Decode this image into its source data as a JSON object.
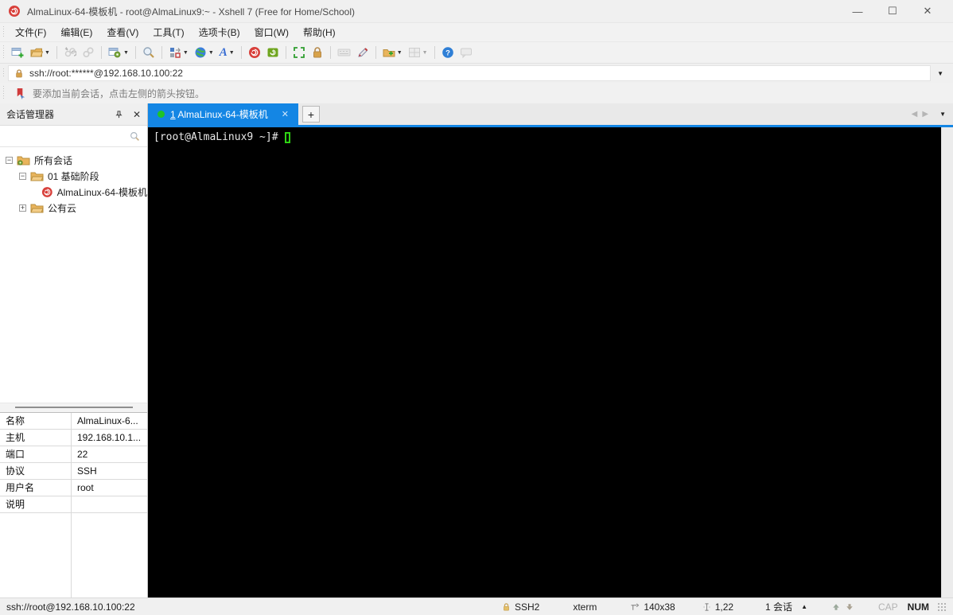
{
  "window": {
    "title": "AlmaLinux-64-模板机 - root@AlmaLinux9:~ - Xshell 7 (Free for Home/School)"
  },
  "menubar": {
    "items": [
      "文件(F)",
      "编辑(E)",
      "查看(V)",
      "工具(T)",
      "选项卡(B)",
      "窗口(W)",
      "帮助(H)"
    ]
  },
  "toolbar": {
    "buttons": [
      "new-session",
      "open-sessions",
      "disconnect",
      "reconnect",
      "session-properties",
      "find",
      "layout",
      "encoding-globe",
      "font",
      "new-xshell-window",
      "new-xftp-transfer",
      "fullscreen",
      "lock-screen",
      "virtual-keyboard",
      "compose-pen",
      "new-session-folder",
      "tile-windows",
      "help",
      "feedback"
    ]
  },
  "address_bar": {
    "url": "ssh://root:******@192.168.10.100:22"
  },
  "info_bar": {
    "message": "要添加当前会话，点击左侧的箭头按钮。"
  },
  "session_manager": {
    "title": "会话管理器",
    "tree": [
      {
        "label": "所有会话",
        "level": 0,
        "expanded": true
      },
      {
        "label": "01 基础阶段",
        "level": 1,
        "expanded": true
      },
      {
        "label": "AlmaLinux-64-模板机",
        "level": 2
      },
      {
        "label": "公有云",
        "level": 1,
        "expanded": false
      }
    ]
  },
  "tabs": {
    "active_number": "1",
    "active_label": "AlmaLinux-64-模板机",
    "new_tab_label": "+"
  },
  "terminal": {
    "prompt": "[root@AlmaLinux9 ~]# "
  },
  "properties": {
    "rows": [
      {
        "label": "名称",
        "value": "AlmaLinux-6..."
      },
      {
        "label": "主机",
        "value": "192.168.10.1..."
      },
      {
        "label": "端口",
        "value": "22"
      },
      {
        "label": "协议",
        "value": "SSH"
      },
      {
        "label": "用户名",
        "value": "root"
      },
      {
        "label": "说明",
        "value": ""
      }
    ]
  },
  "status_bar": {
    "url": "ssh://root@192.168.10.100:22",
    "protocol": "SSH2",
    "terminal_type": "xterm",
    "size": "140x38",
    "cursor_position": "1,22",
    "session_count": "1 会话",
    "cap": "CAP",
    "num": "NUM"
  },
  "colors": {
    "accent_blue": "#1486e4",
    "session_dot_green": "#1fc426",
    "cursor_green": "#2ed313",
    "terminal_bg": "#000000",
    "xshell_red": "#d8403b",
    "xftp_green": "#6fa51f",
    "folder_yellow": "#f3c椀"
  }
}
